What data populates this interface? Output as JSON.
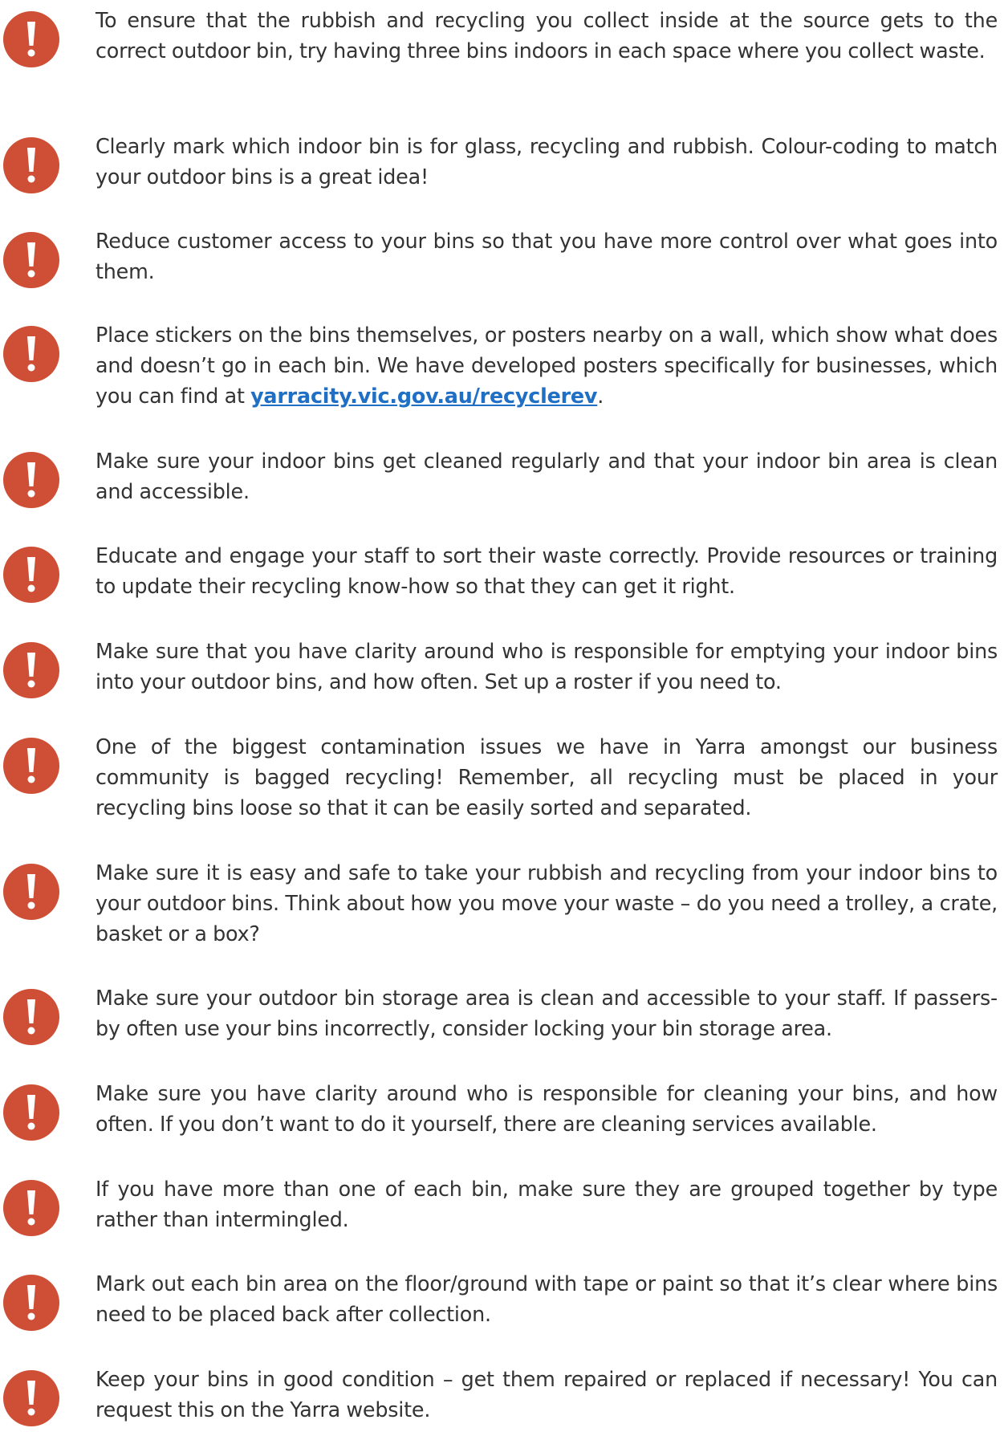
{
  "colors": {
    "icon_fill": "#cf4f36",
    "icon_glyph": "#ffffff",
    "text": "#333333",
    "link": "#1f6fc5"
  },
  "icon_name": "exclamation-icon",
  "tips": [
    {
      "text": "To ensure that the rubbish and recycling you collect inside at the source gets to the correct outdoor bin, try having three bins indoors in each space where you collect waste."
    },
    {
      "text": "Clearly mark which indoor bin is for glass, recycling and rubbish. Colour-coding to match your outdoor bins is a great idea!"
    },
    {
      "text": "Reduce customer access to your bins so that you have more control over what goes into them."
    },
    {
      "text": "Place stickers on the bins themselves, or posters nearby on a wall, which show what does and doesn’t go in each bin. We have developed posters specifically for businesses, which you can find at ",
      "link": "yarracity.vic.gov.au/recyclerev",
      "after": "."
    },
    {
      "text": "Make sure your indoor bins get cleaned regularly and that your indoor bin area is clean and accessible."
    },
    {
      "text": "Educate and engage your staff to sort their waste correctly. Provide resources or training to update their recycling know-how so that they can get it right."
    },
    {
      "text": "Make sure that you have clarity around who is responsible for emptying your indoor bins into your outdoor bins, and how often. Set up a roster if you need to."
    },
    {
      "text": "One of the biggest contamination issues we have in Yarra amongst our business community is bagged recycling! Remember, all recycling must be placed in your recycling bins loose so that it can be easily sorted and separated."
    },
    {
      "text": "Make sure it is easy and safe to take your rubbish and recycling from your indoor bins to your outdoor bins. Think about how you move your waste – do you need a trolley, a crate, basket or a box?"
    },
    {
      "text": "Make sure your outdoor bin storage area is clean and accessible to your staff. If passers-by often use your bins incorrectly, consider locking your bin storage area."
    },
    {
      "text": "Make sure you have clarity around who is responsible for cleaning your bins, and how often. If you don’t want to do it yourself, there are cleaning services available."
    },
    {
      "text": "If you have more than one of each bin, make sure they are grouped together by type rather than intermingled."
    },
    {
      "text": "Mark out each bin area on the floor/ground with tape or paint so that it’s clear where bins need to be placed back after collection."
    },
    {
      "text": "Keep your bins in good condition – get them repaired or replaced if necessary! You can request this on the Yarra website."
    }
  ]
}
